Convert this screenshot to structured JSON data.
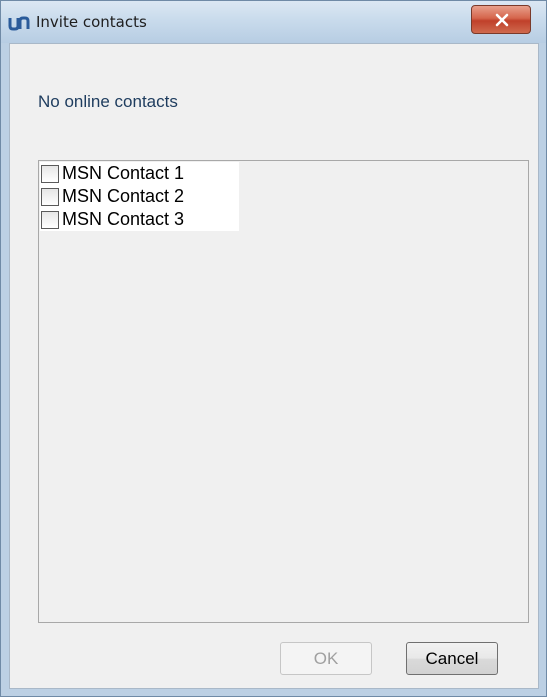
{
  "window": {
    "title": "Invite contacts",
    "app_icon": "un-logo-icon",
    "close_icon": "close-icon"
  },
  "dialog": {
    "status_text": "No online contacts",
    "contacts": [
      {
        "label": "MSN Contact 1",
        "checked": false
      },
      {
        "label": "MSN Contact 2",
        "checked": false
      },
      {
        "label": "MSN Contact 3",
        "checked": false
      }
    ],
    "ok_label": "OK",
    "ok_enabled": false,
    "cancel_label": "Cancel"
  },
  "colors": {
    "titlebar": "#c9dbec",
    "close_button": "#c0402a",
    "status_text": "#1e3c5e",
    "app_icon": "#2a5b9a"
  }
}
